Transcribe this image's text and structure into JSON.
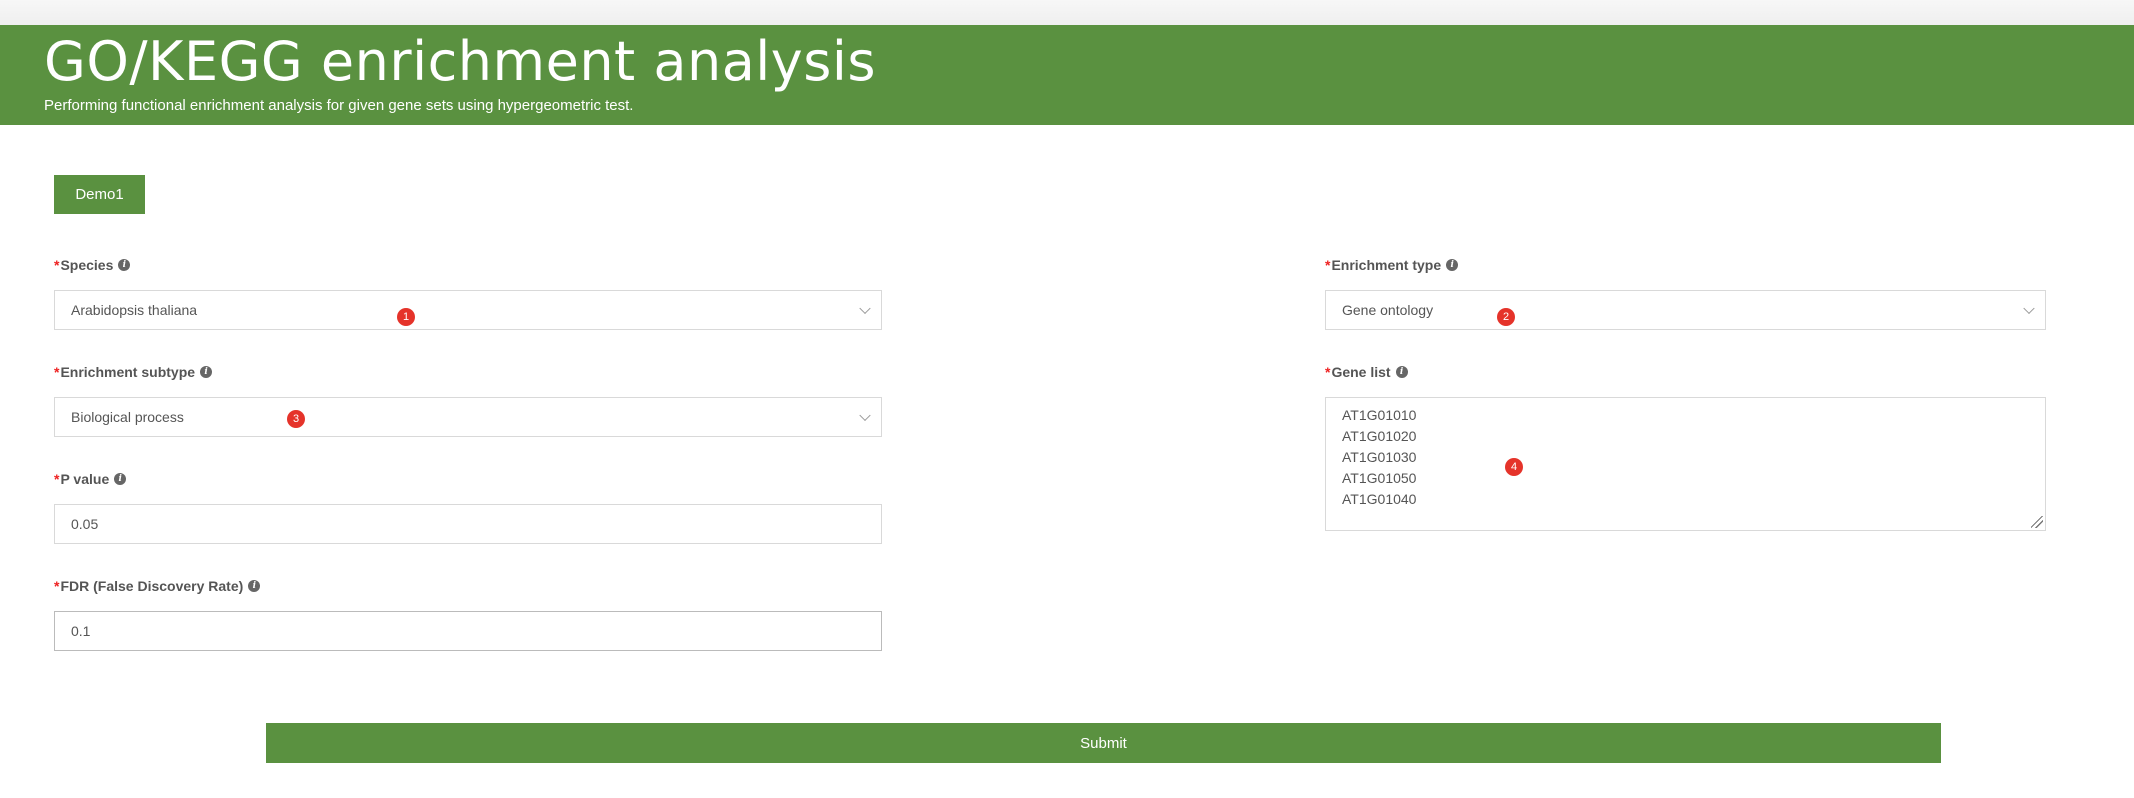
{
  "header": {
    "title": "GO/KEGG enrichment analysis",
    "subtitle": "Performing functional enrichment analysis for given gene sets using hypergeometric test."
  },
  "demo_button": {
    "label": "Demo1"
  },
  "form": {
    "required_mark": "*",
    "species": {
      "label": "Species",
      "value": "Arabidopsis thaliana",
      "marker": "1"
    },
    "enrichment_type": {
      "label": "Enrichment type",
      "value": "Gene ontology",
      "marker": "2"
    },
    "enrichment_subtype": {
      "label": "Enrichment subtype",
      "value": "Biological process",
      "marker": "3"
    },
    "gene_list": {
      "label": "Gene list",
      "genes": [
        "AT1G01010",
        "AT1G01020",
        "AT1G01030",
        "AT1G01050",
        "AT1G01040"
      ],
      "marker": "4"
    },
    "p_value": {
      "label": "P value",
      "value": "0.05"
    },
    "fdr": {
      "label": "FDR (False Discovery Rate)",
      "value": "0.1"
    }
  },
  "submit_button": {
    "label": "Submit"
  },
  "icons": {
    "info": "info-icon",
    "dropdown": "chevron-down-icon"
  },
  "colors": {
    "brand_green": "#5a9140",
    "required_red": "#e22222",
    "marker_red": "#e5332a"
  }
}
